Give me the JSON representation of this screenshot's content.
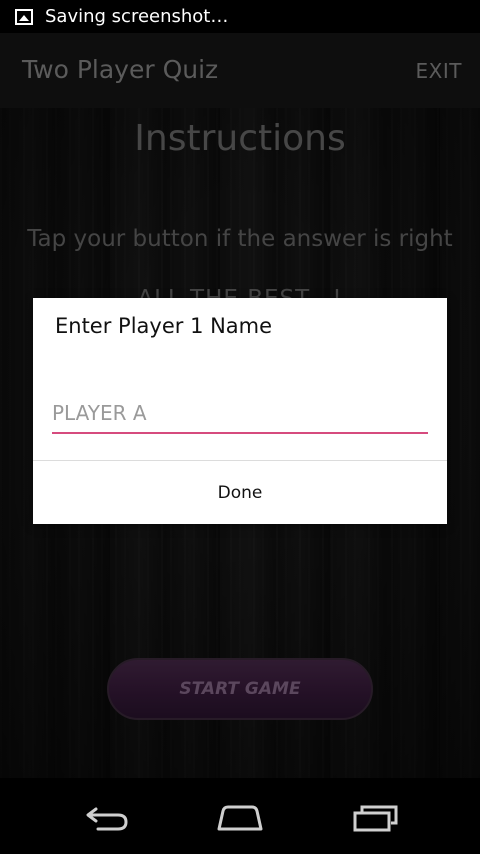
{
  "status_bar": {
    "icon": "image-icon",
    "text": "Saving screenshot…"
  },
  "action_bar": {
    "title": "Two Player Quiz",
    "exit_label": "EXIT"
  },
  "content": {
    "heading": "Instructions",
    "instruction": "Tap your button if the answer is right",
    "partial_text": "ALL THE BEST...!",
    "start_button": "START GAME"
  },
  "dialog": {
    "title": "Enter Player 1 Name",
    "input_placeholder": "PLAYER A",
    "input_value": "",
    "done_label": "Done",
    "accent_color": "#d64b7e"
  },
  "nav_bar": {
    "back_icon": "back-icon",
    "home_icon": "home-icon",
    "recents_icon": "recents-icon"
  }
}
